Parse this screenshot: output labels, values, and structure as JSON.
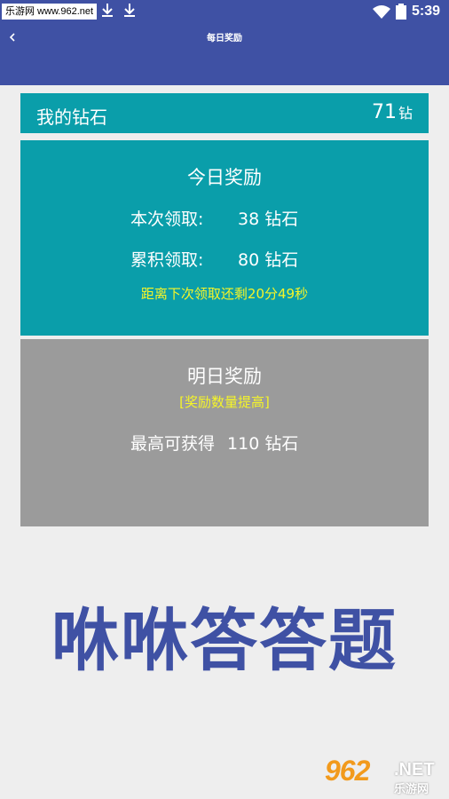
{
  "status_bar": {
    "watermark": "乐游网 www.962.net",
    "time": "5:39"
  },
  "app_bar": {
    "title": "每日奖励"
  },
  "my_diamonds": {
    "label": "我的钻石",
    "value": "71",
    "unit": "钻"
  },
  "today": {
    "title": "今日奖励",
    "current_label": "本次领取:",
    "current_value": "38 钻石",
    "total_label": "累积领取:",
    "total_value": "80 钻石",
    "countdown": "距离下次领取还剩20分49秒"
  },
  "tomorrow": {
    "title": "明日奖励",
    "subtitle": "[奖励数量提高]",
    "max_label": "最高可获得",
    "max_value": "110 钻石"
  },
  "banner": {
    "text": "咻咻答答题"
  },
  "watermark_logo": {
    "number": "962",
    "suffix": ".NET",
    "cn": "乐游网"
  },
  "colors": {
    "primary": "#3f51a4",
    "teal": "#0a9eaa",
    "gray_card": "#9b9b9b",
    "highlight": "#f5f528",
    "background": "#eeeeee"
  },
  "icons": [
    "download-icon",
    "download-icon",
    "wifi-icon",
    "battery-icon",
    "back-arrow-icon"
  ]
}
